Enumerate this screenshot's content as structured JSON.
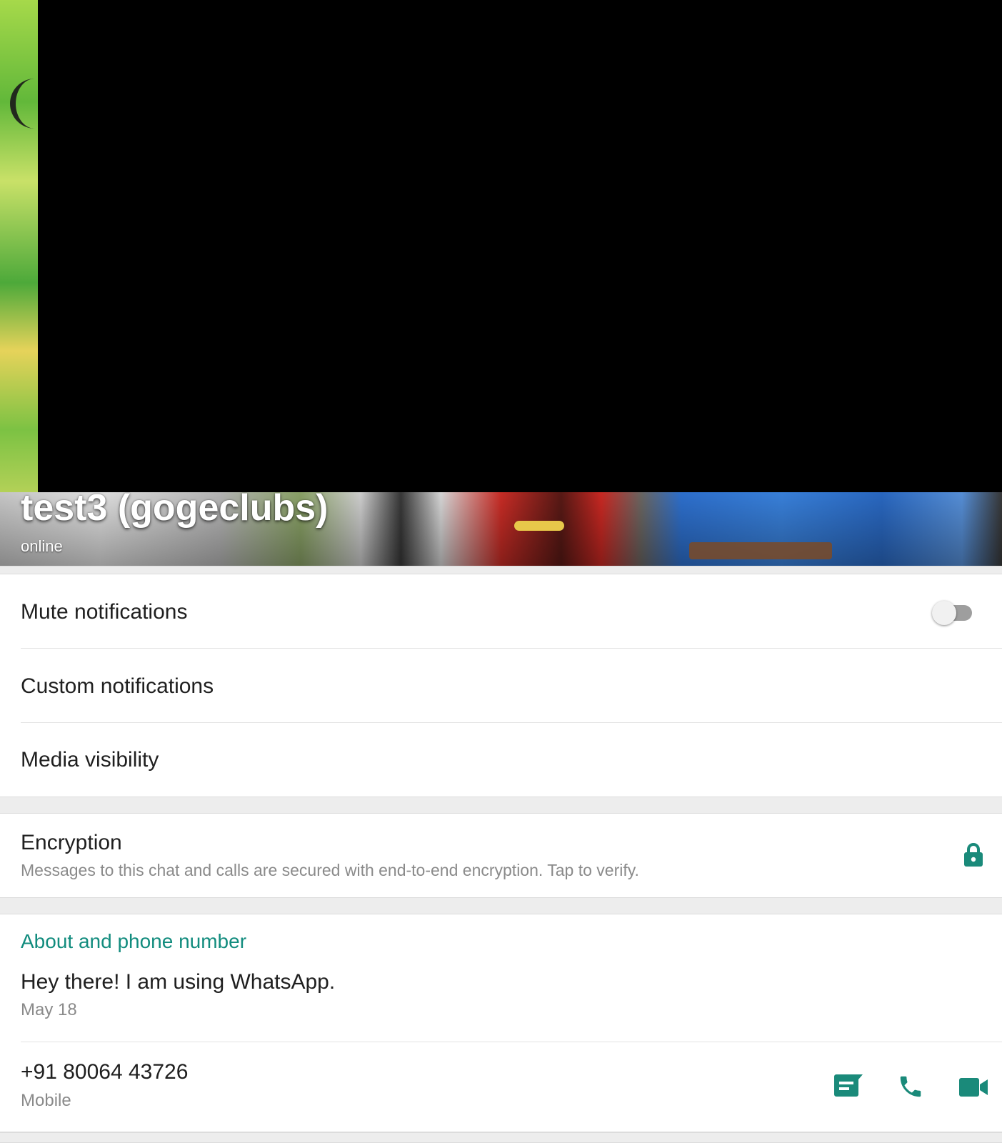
{
  "contact": {
    "name": "test3 (gogeclubs)",
    "status": "online"
  },
  "settings": {
    "mute_label": "Mute notifications",
    "mute_enabled": false,
    "custom_label": "Custom notifications",
    "media_label": "Media visibility"
  },
  "encryption": {
    "title": "Encryption",
    "description": "Messages to this chat and calls are secured with end-to-end encryption. Tap to verify.",
    "icon": "lock-icon"
  },
  "about": {
    "section_title": "About and phone number",
    "text": "Hey there! I am using WhatsApp.",
    "date": "May 18",
    "phone": "+91 80064 43726",
    "phone_type": "Mobile",
    "icons": [
      "message-icon",
      "phone-call-icon",
      "video-call-icon"
    ]
  },
  "colors": {
    "accent": "#128c7e",
    "icon": "#1a8a7a",
    "divider": "#e3e3e3",
    "section_bg": "#ededed",
    "secondary_text": "#8a8a8a"
  }
}
